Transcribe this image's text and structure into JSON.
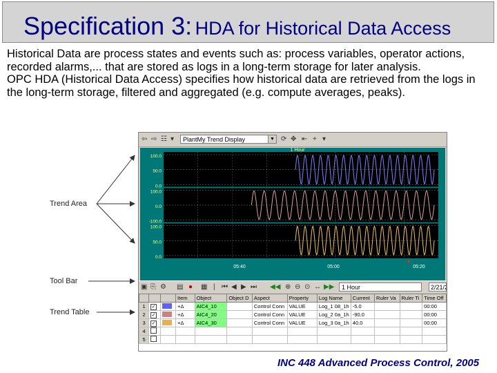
{
  "title": {
    "main": "Specification 3:",
    "sub": "HDA for Historical Data Access"
  },
  "paragraphs": [
    "Historical Data are process states and events such as: process variables, operator actions, recorded alarms,... that are stored as logs in a long-term storage for later analysis.",
    "OPC HDA (Historical Data Access) specifies how historical data are retrieved from the logs in the long-term storage, filtered and aggregated  (e.g. compute averages, peaks)."
  ],
  "callouts": {
    "trend_area": "Trend Area",
    "tool_bar": "Tool Bar",
    "trend_table": "Trend Table"
  },
  "footer": "INC 448 Advanced Process Control, 2005",
  "app": {
    "trend_display": "PlantMy Trend Display",
    "time_span": "1 Hour",
    "range_value": "1 Hour",
    "range_value2": "2/21/2",
    "pane1_ticks": [
      "100.0",
      "50.0",
      "0.0"
    ],
    "pane2_ticks": [
      "100.0",
      "0.0",
      "-100.0"
    ],
    "pane3_ticks": [
      "100.0",
      "50.0",
      "0.0"
    ],
    "x_ticks": [
      "05:40",
      "05:00",
      "05:20"
    ],
    "colors": {
      "background": "#000000",
      "plot_bg": "#007878",
      "series1": "#8080ff",
      "series2": "#e0a0a0",
      "series3": "#f0c060"
    }
  },
  "table": {
    "headers": [
      "",
      "",
      "",
      "Item",
      "Object",
      "Object D",
      "Aspect",
      "Property",
      "Log Name",
      "Current",
      "Ruler Va",
      "Ruler Ti",
      "Time Off"
    ],
    "rows": [
      {
        "num": "1",
        "checked": "✓",
        "color": "#6060ff",
        "item": "+Δ",
        "object": "AIC4_10",
        "object_d": "",
        "aspect": "Control Conn",
        "property": "VALUE",
        "log": "Log_1 08_1h",
        "current": "-5.0",
        "ruler_va": "",
        "ruler_ti": "",
        "time_off": "00:00"
      },
      {
        "num": "2",
        "checked": "✓",
        "color": "#d08080",
        "item": "+Δ",
        "object": "AIC4_20",
        "object_d": "",
        "aspect": "Control Conn",
        "property": "VALUE",
        "log": "Log_2 0a_1h",
        "current": "-90.0",
        "ruler_va": "",
        "ruler_ti": "",
        "time_off": "00:00"
      },
      {
        "num": "3",
        "checked": "✓",
        "color": "#e8b050",
        "item": "+Δ",
        "object": "AIC4_30",
        "object_d": "",
        "aspect": "Control Conn",
        "property": "VALUE",
        "log": "Log_3 0a_1h",
        "current": "40.0",
        "ruler_va": "",
        "ruler_ti": "",
        "time_off": "00:00"
      },
      {
        "num": "4",
        "checked": "",
        "color": "#ffffff",
        "item": "",
        "object": "",
        "object_d": "",
        "aspect": "",
        "property": "",
        "log": "",
        "current": "",
        "ruler_va": "",
        "ruler_ti": "",
        "time_off": ""
      },
      {
        "num": "5",
        "checked": "",
        "color": "#ffffff",
        "item": "",
        "object": "",
        "object_d": "",
        "aspect": "",
        "property": "",
        "log": "",
        "current": "",
        "ruler_va": "",
        "ruler_ti": "",
        "time_off": ""
      }
    ]
  }
}
